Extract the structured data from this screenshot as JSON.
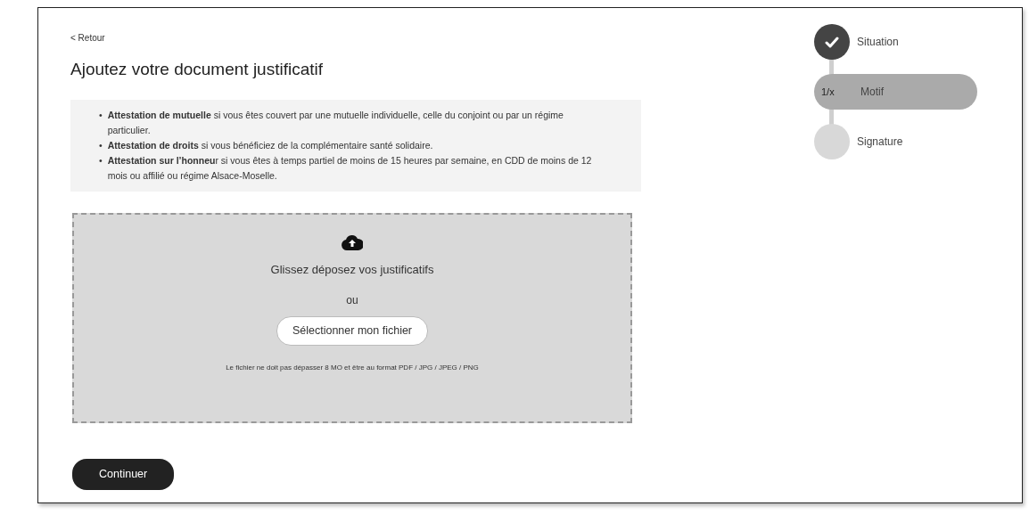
{
  "back_link": "< Retour",
  "title": "Ajoutez votre document justificatif",
  "info_items": [
    {
      "marker": "•",
      "text": "**Attestation de mutuelle** si vous êtes couvert par une mutuelle individuelle, celle du conjoint ou par un régime particulier."
    },
    {
      "marker": "•",
      "text": "**Attestation de droits** si vous bénéficiez de la complémentaire santé solidaire."
    },
    {
      "marker": "•",
      "text": "**Attestation sur l’honneu**r si vous êtes à temps partiel de moins de 15 heures par semaine, en CDD de moins de 12 mois ou affilié ou régime Alsace-Moselle."
    }
  ],
  "dropzone": {
    "instruction": "Glissez déposez vos justificatifs",
    "separator": "ou",
    "button": "Sélectionner mon fichier",
    "note": "Le fichier ne doit pas dépasser 8 MO et être au format PDF / JPG / JPEG / PNG"
  },
  "continue_button": "Continuer",
  "steps": [
    {
      "label": "Situation",
      "kind": "done"
    },
    {
      "label": "Motif",
      "kind": "current",
      "counter": "1/x"
    },
    {
      "label": "Signature",
      "kind": "pending"
    }
  ]
}
